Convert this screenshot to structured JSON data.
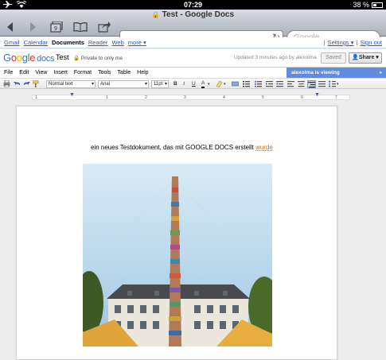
{
  "status": {
    "time": "07:29",
    "battery": "38 %"
  },
  "browser": {
    "page_title": "Test - Google Docs",
    "url": "",
    "search_placeholder": "Google"
  },
  "gbar": {
    "links": [
      "Gmail",
      "Calendar",
      "Documents",
      "Reader",
      "Web",
      "more ▾"
    ],
    "current_index": 2,
    "settings": "Settings ▾",
    "sign_out": "Sign out"
  },
  "doc_header": {
    "logo_google": "Google",
    "logo_docs": "docs",
    "title": "Test",
    "privacy": "Private to only me",
    "updated": "Updated 3 minutes ago by alexolma",
    "saved_label": "Saved",
    "share_label": "Share ▾"
  },
  "menu": {
    "items": [
      "File",
      "Edit",
      "View",
      "Insert",
      "Format",
      "Tools",
      "Table",
      "Help"
    ],
    "viewing_badge": "alexolma is viewing",
    "viewing_chevron": "»"
  },
  "format_toolbar": {
    "style_select": "Normal text",
    "font_select": "Arial",
    "size_select": "11pt",
    "bold": "B",
    "italic": "I",
    "underline": "U",
    "text_color": "A"
  },
  "ruler": {
    "numbers": [
      "1",
      "1",
      "2",
      "3",
      "4",
      "5",
      "6",
      "7"
    ]
  },
  "document": {
    "text_before": "ein neues Testdokument, das mit GOOGLE DOCS erstellt ",
    "text_misspelled": "wurde"
  },
  "colors": {
    "link": "#2d55b3",
    "viewing_badge": "#5e8cde",
    "spell_underline": "#d76b00"
  }
}
